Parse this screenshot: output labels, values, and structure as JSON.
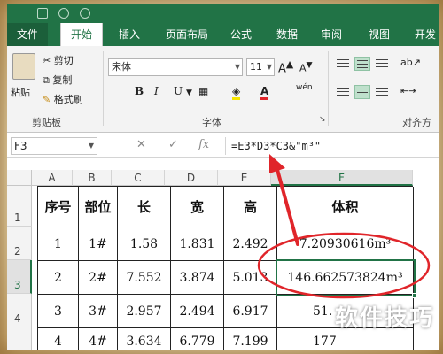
{
  "ribbon_tabs": [
    "文件",
    "开始",
    "插入",
    "页面布局",
    "公式",
    "数据",
    "审阅",
    "视图",
    "开发"
  ],
  "active_tab": "开始",
  "clipboard": {
    "paste_label": "粘贴",
    "cut_label": "剪切",
    "copy_label": "复制",
    "format_painter_label": "格式刷",
    "group_label": "剪贴板"
  },
  "font": {
    "font_name": "宋体",
    "font_size": "11",
    "bold": "B",
    "italic": "I",
    "underline": "U",
    "font_color_letter": "A",
    "wen_label": "wén",
    "group_label": "字体"
  },
  "alignment": {
    "group_label": "对齐方"
  },
  "formula_bar": {
    "name_box": "F3",
    "formula": "=E3*D3*C3&\"m³\"",
    "cancel_symbol": "✕",
    "enter_symbol": "✓",
    "fx_symbol": "fx"
  },
  "sheet": {
    "columns": [
      "A",
      "B",
      "C",
      "D",
      "E",
      "F"
    ],
    "rows": [
      "1",
      "2",
      "3",
      "4"
    ],
    "selected_cell": "F3",
    "header": [
      "序号",
      "部位",
      "长",
      "宽",
      "高",
      "体积"
    ],
    "data": [
      [
        "1",
        "1#",
        "1.58",
        "1.831",
        "2.492",
        "7.20930616m³"
      ],
      [
        "2",
        "2#",
        "7.552",
        "3.874",
        "5.013",
        "146.662573824m³"
      ],
      [
        "3",
        "3#",
        "2.957",
        "2.494",
        "6.917",
        "51."
      ],
      [
        "4",
        "4#",
        "3.634",
        "6.779",
        "7.199",
        "177"
      ]
    ]
  },
  "watermark": "软件技巧",
  "colors": {
    "excel_green": "#217346",
    "annotation_red": "#e0252a"
  }
}
